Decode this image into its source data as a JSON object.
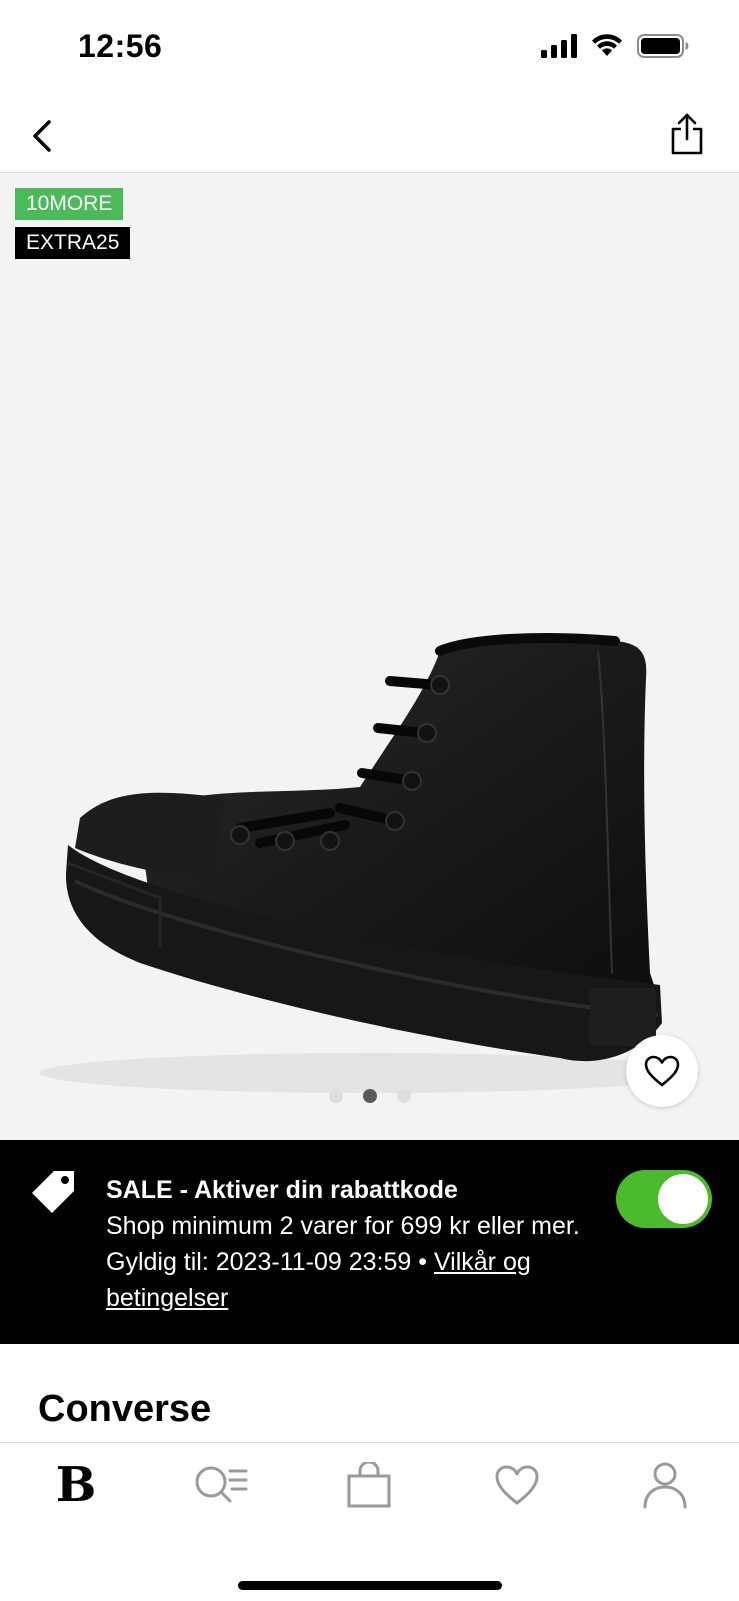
{
  "status_bar": {
    "time": "12:56"
  },
  "nav": {
    "back_icon": "chevron-left-icon",
    "share_icon": "share-icon"
  },
  "gallery": {
    "badges": [
      "10MORE",
      "EXTRA25"
    ],
    "image_count": 3,
    "active_index": 1
  },
  "promo": {
    "title": "SALE - Aktiver din rabattkode",
    "body": "Shop minimum 2 varer for 699 kr eller mer. Gyldig til: 2023-11-09 23:59 •",
    "link": "Vilkår og betingelser",
    "toggle_on": true
  },
  "product": {
    "brand": "Converse"
  },
  "tab_bar": {
    "logo": "B",
    "tabs": [
      "home",
      "search",
      "bag",
      "favorites",
      "account"
    ]
  },
  "colors": {
    "badge_green": "#4cba5a",
    "toggle_green": "#4cba2e",
    "gallery_bg": "#f3f3f3"
  }
}
